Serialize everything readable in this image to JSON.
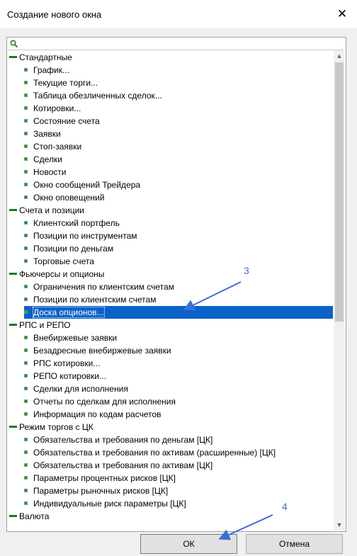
{
  "window": {
    "title": "Создание нового окна",
    "close_glyph": "✕"
  },
  "search": {
    "value": "",
    "placeholder": ""
  },
  "tree": [
    {
      "type": "group",
      "label": "Стандартные"
    },
    {
      "type": "item",
      "label": "График..."
    },
    {
      "type": "item",
      "label": "Текущие торги..."
    },
    {
      "type": "item",
      "label": "Таблица обезличенных сделок..."
    },
    {
      "type": "item",
      "label": "Котировки..."
    },
    {
      "type": "item",
      "label": "Состояние счета"
    },
    {
      "type": "item",
      "label": "Заявки"
    },
    {
      "type": "item",
      "label": "Стоп-заявки"
    },
    {
      "type": "item",
      "label": "Сделки"
    },
    {
      "type": "item",
      "label": "Новости"
    },
    {
      "type": "item",
      "label": "Окно сообщений Трейдера"
    },
    {
      "type": "item",
      "label": "Окно оповещений"
    },
    {
      "type": "group",
      "label": "Счета и позиции"
    },
    {
      "type": "item",
      "label": "Клиентский портфель"
    },
    {
      "type": "item",
      "label": "Позиции по инструментам"
    },
    {
      "type": "item",
      "label": "Позиции по деньгам"
    },
    {
      "type": "item",
      "label": "Торговые счета"
    },
    {
      "type": "group",
      "label": "Фьючерсы и опционы"
    },
    {
      "type": "item",
      "label": "Ограничения по клиентским счетам"
    },
    {
      "type": "item",
      "label": "Позиции по клиентским счетам"
    },
    {
      "type": "item",
      "label": "Доска опционов...",
      "selected": true
    },
    {
      "type": "group",
      "label": "РПС и РЕПО"
    },
    {
      "type": "item",
      "label": "Внебиржевые заявки"
    },
    {
      "type": "item",
      "label": "Безадресные внебиржевые заявки"
    },
    {
      "type": "item",
      "label": "РПС котировки..."
    },
    {
      "type": "item",
      "label": "РЕПО котировки..."
    },
    {
      "type": "item",
      "label": "Сделки для исполнения"
    },
    {
      "type": "item",
      "label": "Отчеты по сделкам для исполнения"
    },
    {
      "type": "item",
      "label": "Информация по кодам расчетов"
    },
    {
      "type": "group",
      "label": "Режим торгов с ЦК"
    },
    {
      "type": "item",
      "label": "Обязательства и требования по деньгам [ЦК]"
    },
    {
      "type": "item",
      "label": "Обязательства и требования по активам (расширенные) [ЦК]"
    },
    {
      "type": "item",
      "label": "Обязательства и требования по активам [ЦК]"
    },
    {
      "type": "item",
      "label": "Параметры процентных рисков [ЦК]"
    },
    {
      "type": "item",
      "label": "Параметры рыночных рисков [ЦК]"
    },
    {
      "type": "item",
      "label": "Индивидуальные риск параметры [ЦК]"
    },
    {
      "type": "group",
      "label": "Валюта"
    }
  ],
  "buttons": {
    "ok": "ОК",
    "cancel": "Отмена"
  },
  "annotations": [
    {
      "label": "3",
      "color": "#3b6fd6"
    },
    {
      "label": "4",
      "color": "#3b6fd6"
    }
  ],
  "icons": {
    "search": "search-icon",
    "scroll_up": "chevron-up-icon",
    "scroll_down": "chevron-down-icon"
  }
}
